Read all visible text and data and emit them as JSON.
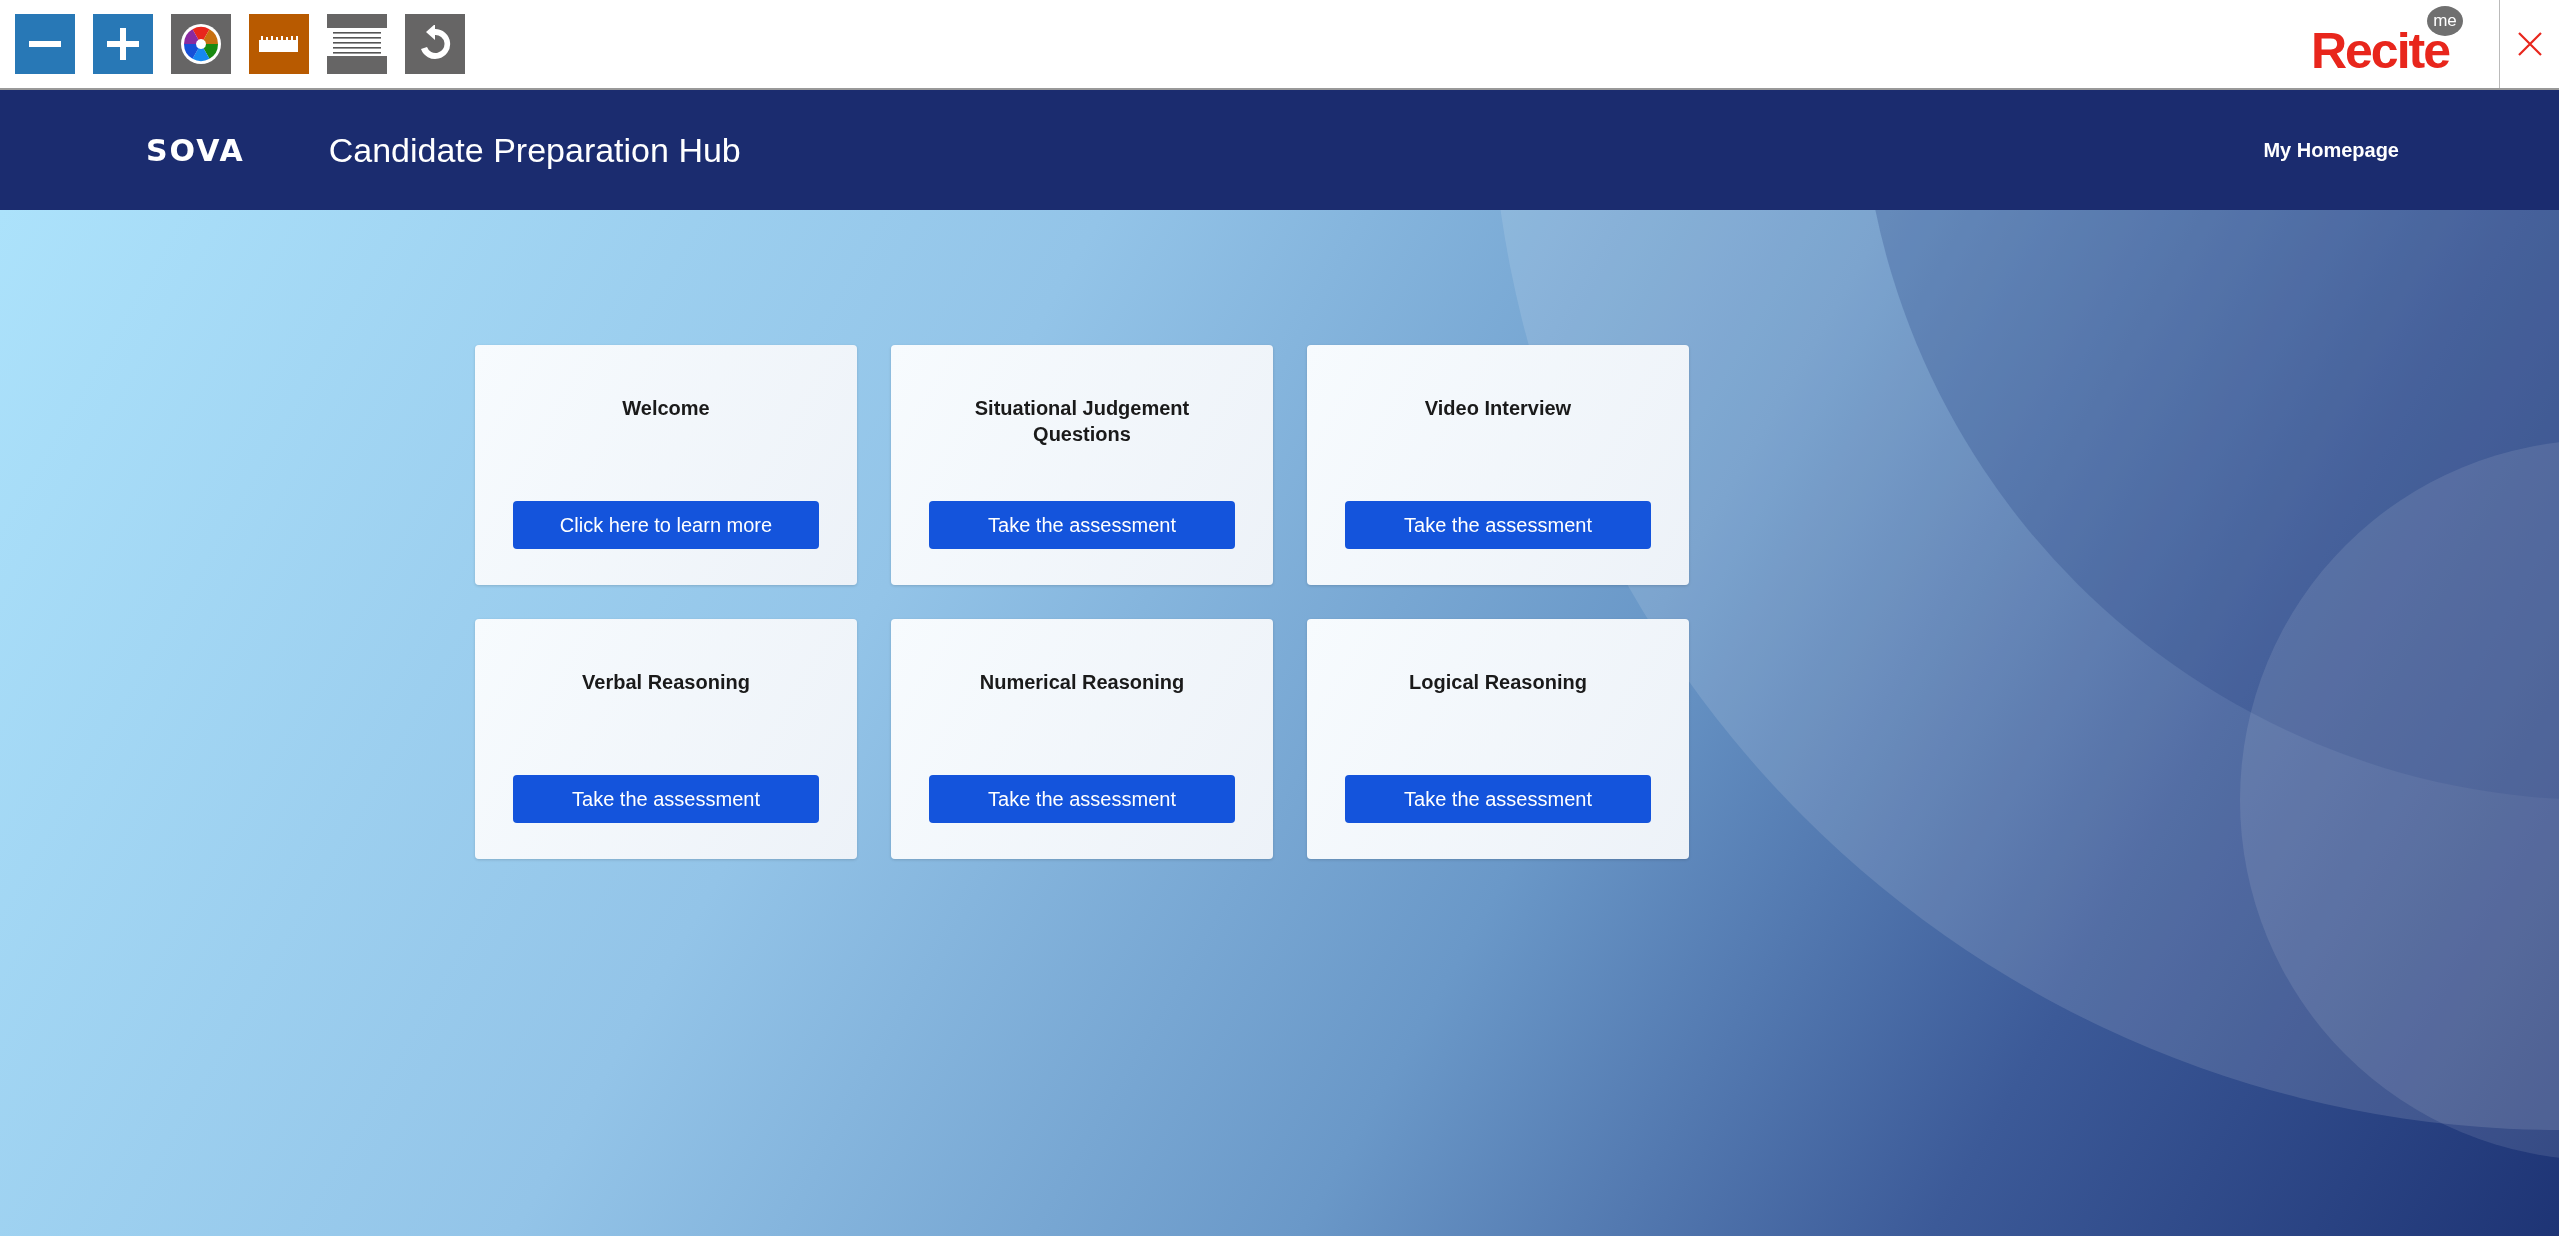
{
  "toolbar": {
    "buttons": [
      {
        "kind": "minus"
      },
      {
        "kind": "plus"
      },
      {
        "kind": "colors"
      },
      {
        "kind": "ruler"
      },
      {
        "kind": "reading"
      },
      {
        "kind": "reset"
      }
    ],
    "logo": {
      "word": "Recite",
      "badge": "me"
    }
  },
  "header": {
    "logo": "SOVA",
    "title": "Candidate Preparation Hub",
    "link": "My Homepage"
  },
  "cards": [
    {
      "title": "Welcome",
      "button": "Click here to learn more"
    },
    {
      "title": "Situational Judgement Questions",
      "button": "Take the assessment"
    },
    {
      "title": "Video Interview",
      "button": "Take the assessment"
    },
    {
      "title": "Verbal Reasoning",
      "button": "Take the assessment"
    },
    {
      "title": "Numerical Reasoning",
      "button": "Take the assessment"
    },
    {
      "title": "Logical Reasoning",
      "button": "Take the assessment"
    }
  ]
}
